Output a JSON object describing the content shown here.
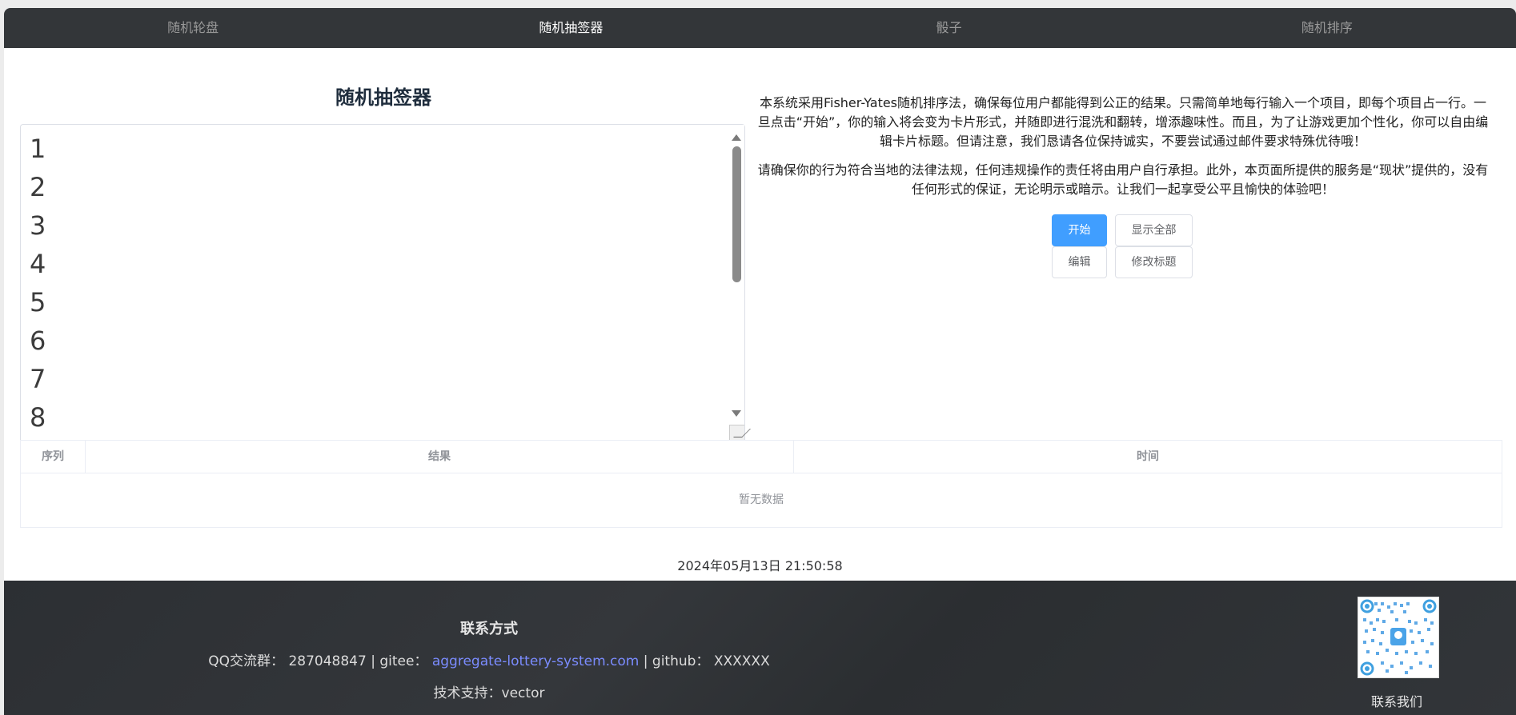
{
  "nav": {
    "tabs": [
      "随机轮盘",
      "随机抽签器",
      "骰子",
      "随机排序"
    ],
    "active_index": 1
  },
  "draw": {
    "title": "随机抽签器",
    "lines": [
      "1",
      "2",
      "3",
      "4",
      "5",
      "6",
      "7",
      "8"
    ]
  },
  "description": {
    "paragraph1": "本系统采用Fisher-Yates随机排序法，确保每位用户都能得到公正的结果。只需简单地每行输入一个项目，即每个项目占一行。一旦点击“开始”，你的输入将会变为卡片形式，并随即进行混洗和翻转，增添趣味性。而且，为了让游戏更加个性化，你可以自由编辑卡片标题。但请注意，我们恳请各位保持诚实，不要尝试通过邮件要求特殊优待哦！",
    "paragraph2": "请确保你的行为符合当地的法律法规，任何违规操作的责任将由用户自行承担。此外，本页面所提供的服务是“现状”提供的，没有任何形式的保证，无论明示或暗示。让我们一起享受公平且愉快的体验吧！"
  },
  "buttons": {
    "start": "开始",
    "show_all": "显示全部",
    "edit": "编辑",
    "edit_title": "修改标题"
  },
  "table": {
    "headers": [
      "序列",
      "结果",
      "时间"
    ],
    "empty_text": "暂无数据"
  },
  "datetime": "2024年05月13日 21:50:58",
  "footer": {
    "heading": "联系方式",
    "qq_label": "QQ交流群：",
    "qq_value": "287048847",
    "sep1": " | ",
    "gitee_label": "gitee：",
    "gitee_link": "aggregate-lottery-system.com",
    "sep2": " | ",
    "github_label": "github：",
    "github_value": "XXXXXX",
    "support": "技术支持：vector",
    "qr_label": "联系我们"
  },
  "colors": {
    "primary": "#409eff",
    "nav_bg": "#333639",
    "footer_bg": "#2c2f33",
    "link": "#7b8cff"
  }
}
